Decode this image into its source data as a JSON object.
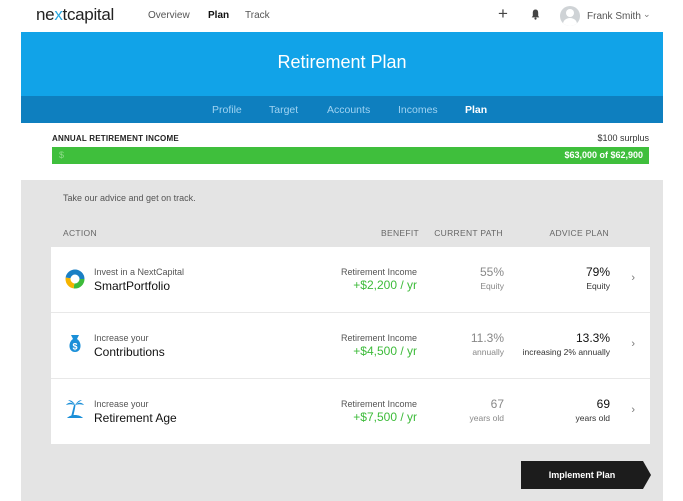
{
  "brand": {
    "logo_pre": "ne",
    "logo_x": "x",
    "logo_post": "tcapital"
  },
  "topnav": {
    "links": [
      "Overview",
      "Plan",
      "Track"
    ],
    "active": "Plan",
    "add_icon": "plus-icon",
    "notifications_icon": "bell-icon",
    "user_name": "Frank Smith",
    "user_menu_icon": "chevron-down-icon"
  },
  "hero": {
    "title": "Retirement Plan",
    "color": "#11a3e8"
  },
  "subnav": {
    "tabs": [
      "Profile",
      "Target",
      "Accounts",
      "Incomes",
      "Plan"
    ],
    "active": "Plan",
    "color": "#0e7fbf"
  },
  "income": {
    "label": "ANNUAL RETIREMENT INCOME",
    "surplus": "$100 surplus",
    "bar_symbol": "$",
    "bar_value": "$63,000 of $62,900",
    "progress_fraction": 1.0,
    "bar_color": "#3fbf3c"
  },
  "advice": {
    "intro": "Take our advice and get on track."
  },
  "columns": {
    "action": "ACTION",
    "benefit": "BENEFIT",
    "current": "CURRENT PATH",
    "advice": "ADVICE PLAN"
  },
  "rows": [
    {
      "icon": "pie-chart-icon",
      "small": "Invest in a NextCapital",
      "big": "SmartPortfolio",
      "benefit_label": "Retirement Income",
      "benefit_value": "+$2,200 / yr",
      "current_value": "55%",
      "current_sub": "Equity",
      "advice_value": "79%",
      "advice_sub": "Equity"
    },
    {
      "icon": "money-bag-icon",
      "small": "Increase your",
      "big": "Contributions",
      "benefit_label": "Retirement Income",
      "benefit_value": "+$4,500 / yr",
      "current_value": "11.3%",
      "current_sub": "annually",
      "advice_value": "13.3%",
      "advice_sub": "increasing 2% annually"
    },
    {
      "icon": "palm-tree-icon",
      "small": "Increase your",
      "big": "Retirement Age",
      "benefit_label": "Retirement Income",
      "benefit_value": "+$7,500 / yr",
      "current_value": "67",
      "current_sub": "years old",
      "advice_value": "69",
      "advice_sub": "years old"
    }
  ],
  "actions": {
    "implement": "Implement Plan"
  },
  "colors": {
    "benefit_green": "#3dbb3a",
    "accent_blue": "#11a3e8"
  }
}
